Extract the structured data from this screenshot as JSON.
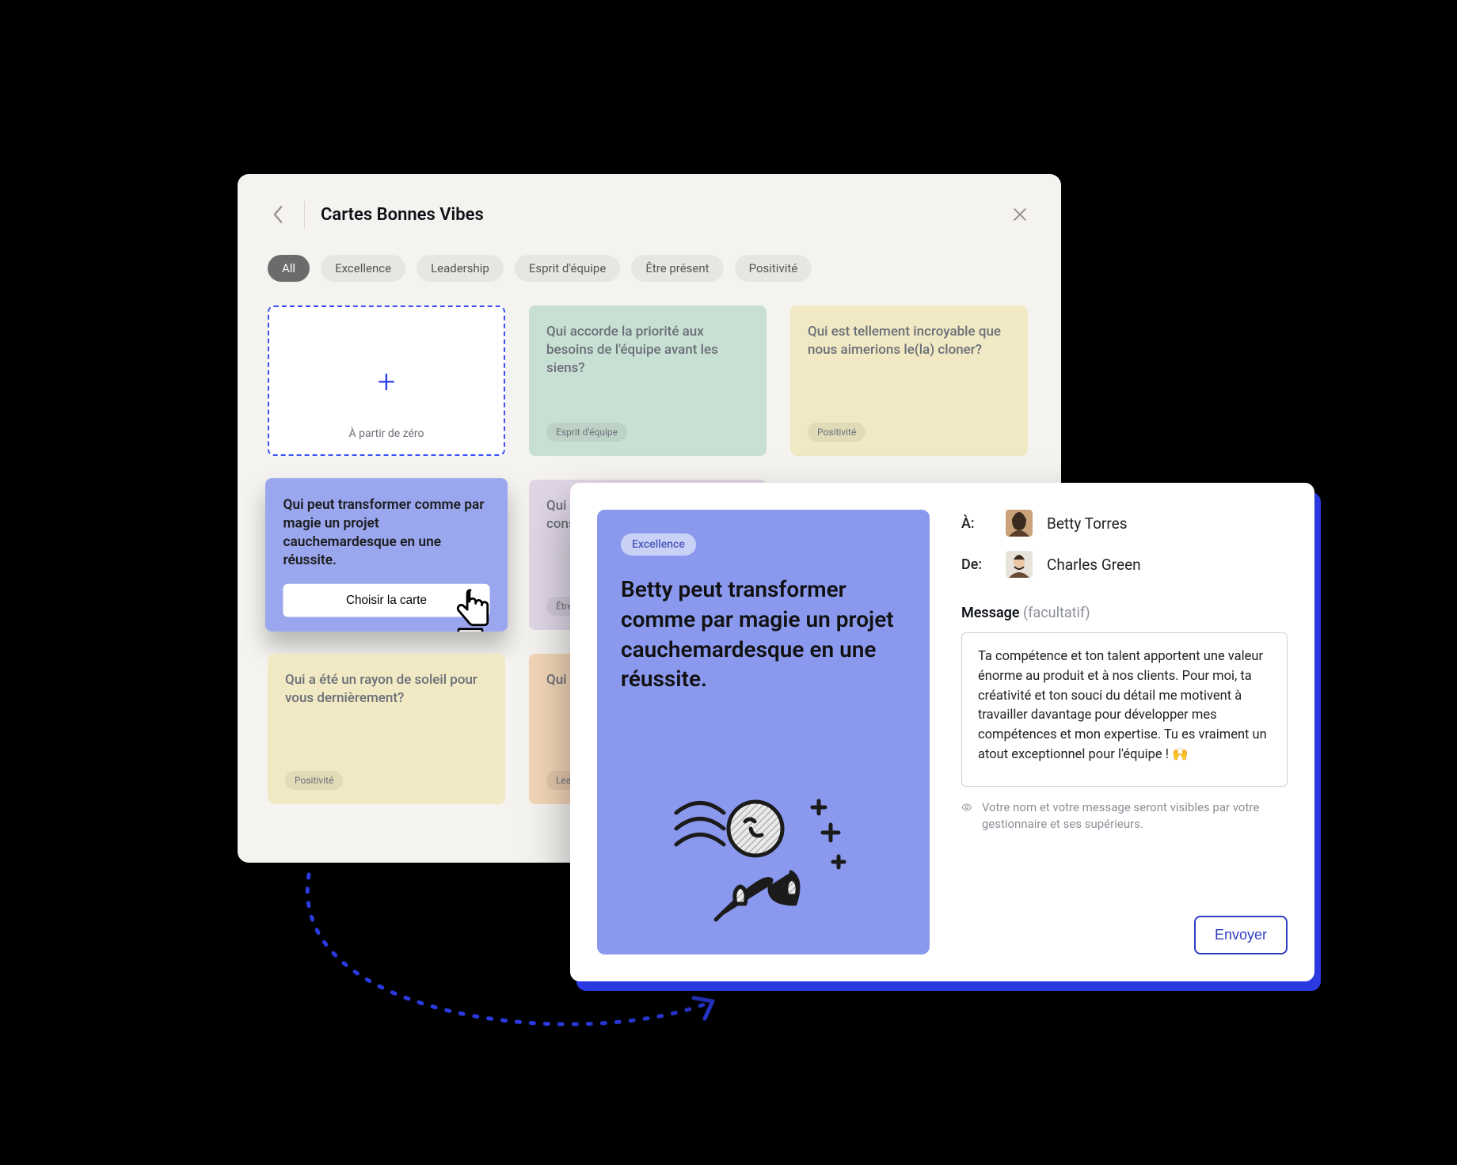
{
  "panel": {
    "title": "Cartes Bonnes Vibes",
    "chips": [
      "All",
      "Excellence",
      "Leadership",
      "Esprit d'équipe",
      "Être présent",
      "Positivité"
    ],
    "blank_label": "À partir de zéro",
    "cards": [
      {
        "kind": "mint",
        "text": "Qui accorde la priorité aux besoins de l'équipe avant les siens?",
        "tag": "Esprit d'équipe"
      },
      {
        "kind": "cream",
        "text": "Qui est tellement incroyable que nous aimerions le(la) cloner?",
        "tag": "Positivité"
      },
      {
        "kind": "choose",
        "text": "Qui peut transformer comme par magie un projet cauchemardesque en une réussite.",
        "button": "Choisir la carte"
      },
      {
        "kind": "lilac",
        "text": "Qui donne toujours de bons conseils?",
        "tag": "Être présent"
      },
      {
        "kind": "cream",
        "text": "Qui a été un rayon de soleil pour vous dernièrement?",
        "tag": "Positivité"
      },
      {
        "kind": "peach",
        "text": "Qui vous aide à vous améliorer?",
        "tag": "Leadership"
      }
    ]
  },
  "compose": {
    "tag": "Excellence",
    "headline": "Betty peut transformer comme par magie un projet cauchemardesque en une réussite.",
    "to_label": "À:",
    "from_label": "De:",
    "to_name": "Betty Torres",
    "from_name": "Charles Green",
    "message_label": "Message",
    "optional": "(facultatif)",
    "message": "Ta compétence et ton talent apportent une valeur énorme au produit et à nos clients. Pour moi, ta créativité et ton souci du détail me motivent à travailler davantage pour développer mes compétences et mon expertise. Tu es vraiment un atout exceptionnel pour l'équipe ! 🙌",
    "visibility": "Votre nom et votre message seront visibles par votre gestionnaire et ses supérieurs.",
    "send": "Envoyer"
  }
}
